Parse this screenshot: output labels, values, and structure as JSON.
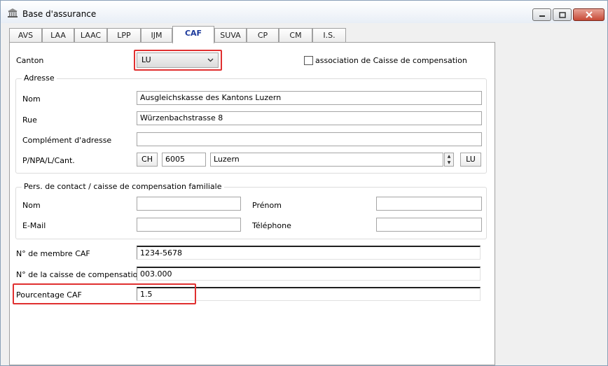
{
  "window": {
    "title": "Base d'assurance"
  },
  "tabs": [
    "AVS",
    "LAA",
    "LAAC",
    "LPP",
    "IJM",
    "CAF",
    "SUVA",
    "CP",
    "CM",
    "I.S."
  ],
  "active_tab": "CAF",
  "canton": {
    "label": "Canton",
    "value": "LU"
  },
  "association": {
    "label": "association de Caisse de compensation",
    "checked": false
  },
  "address": {
    "group_title": "Adresse",
    "name_label": "Nom",
    "name_value": "Ausgleichskasse des Kantons Luzern",
    "street_label": "Rue",
    "street_value": "Würzenbachstrasse 8",
    "complement_label": "Complément d'adresse",
    "complement_value": "",
    "locality_label": "P/NPA/L/Cant.",
    "country": "CH",
    "zip": "6005",
    "city": "Luzern",
    "canton": "LU"
  },
  "contact": {
    "group_title": "Pers. de contact / caisse de compensation familiale",
    "name_label": "Nom",
    "name_value": "",
    "firstname_label": "Prénom",
    "firstname_value": "",
    "email_label": "E-Mail",
    "email_value": "",
    "phone_label": "Téléphone",
    "phone_value": ""
  },
  "fields": {
    "member_label": "N° de membre CAF",
    "member_value": "1234-5678",
    "fund_label": "N° de la caisse de compensation",
    "fund_value": "003.000",
    "percent_label": "Pourcentage CAF",
    "percent_value": "1.5"
  },
  "icons": {
    "title": "building-icon",
    "min": "minimize-icon",
    "max": "maximize-icon",
    "close": "close-icon",
    "dropdown": "chevron-down-icon",
    "spin_up": "arrow-up-icon",
    "spin_down": "arrow-down-icon"
  },
  "colors": {
    "highlight": "#e03030",
    "active_tab_text": "#1d3a9c"
  }
}
